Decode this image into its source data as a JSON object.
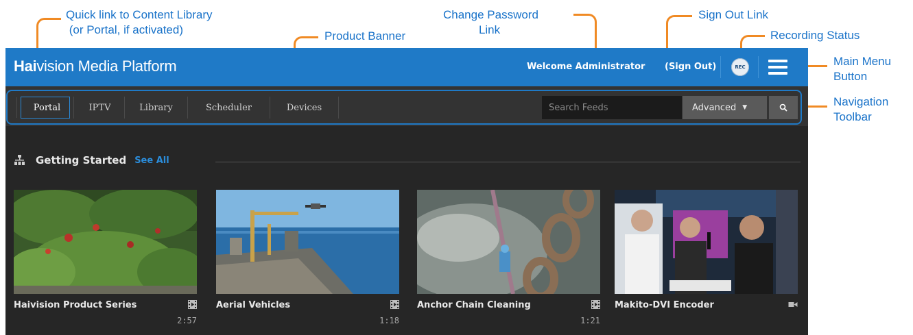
{
  "annotations": {
    "quick_link": "Quick link to Content Library\n (or Portal, if activated)",
    "product_banner": "Product Banner",
    "change_password": "Change Password\n           Link",
    "sign_out_link": "Sign Out Link",
    "recording_status": "Recording Status",
    "main_menu_button": "Main Menu\nButton",
    "navigation_toolbar": "Navigation\nToolbar"
  },
  "banner": {
    "logo_strong": "Hai",
    "logo_rest": "vision Media Platform",
    "welcome_text": "Welcome Administrator",
    "sign_out_text": "(Sign Out)",
    "recording_badge": "REC"
  },
  "nav": {
    "items": [
      {
        "label": "Portal",
        "active": true
      },
      {
        "label": "IPTV",
        "active": false
      },
      {
        "label": "Library",
        "active": false
      },
      {
        "label": "Scheduler",
        "active": false
      },
      {
        "label": "Devices",
        "active": false
      }
    ],
    "search_placeholder": "Search Feeds",
    "advanced_label": "Advanced"
  },
  "section": {
    "title": "Getting Started",
    "see_all": "See All"
  },
  "videos": [
    {
      "title": "Haivision Product Series",
      "duration": "2:57",
      "icon": "film-icon"
    },
    {
      "title": "Aerial Vehicles",
      "duration": "1:18",
      "icon": "film-icon"
    },
    {
      "title": "Anchor Chain Cleaning",
      "duration": "1:21",
      "icon": "film-icon"
    },
    {
      "title": "Makito-DVI Encoder",
      "duration": "",
      "icon": "video-camera-icon"
    }
  ],
  "colors": {
    "banner_blue": "#1f7ac7",
    "annotation_blue": "#1a73c9",
    "annotation_orange": "#f08a24",
    "app_background": "#262626",
    "link_blue": "#2b8ddb"
  }
}
